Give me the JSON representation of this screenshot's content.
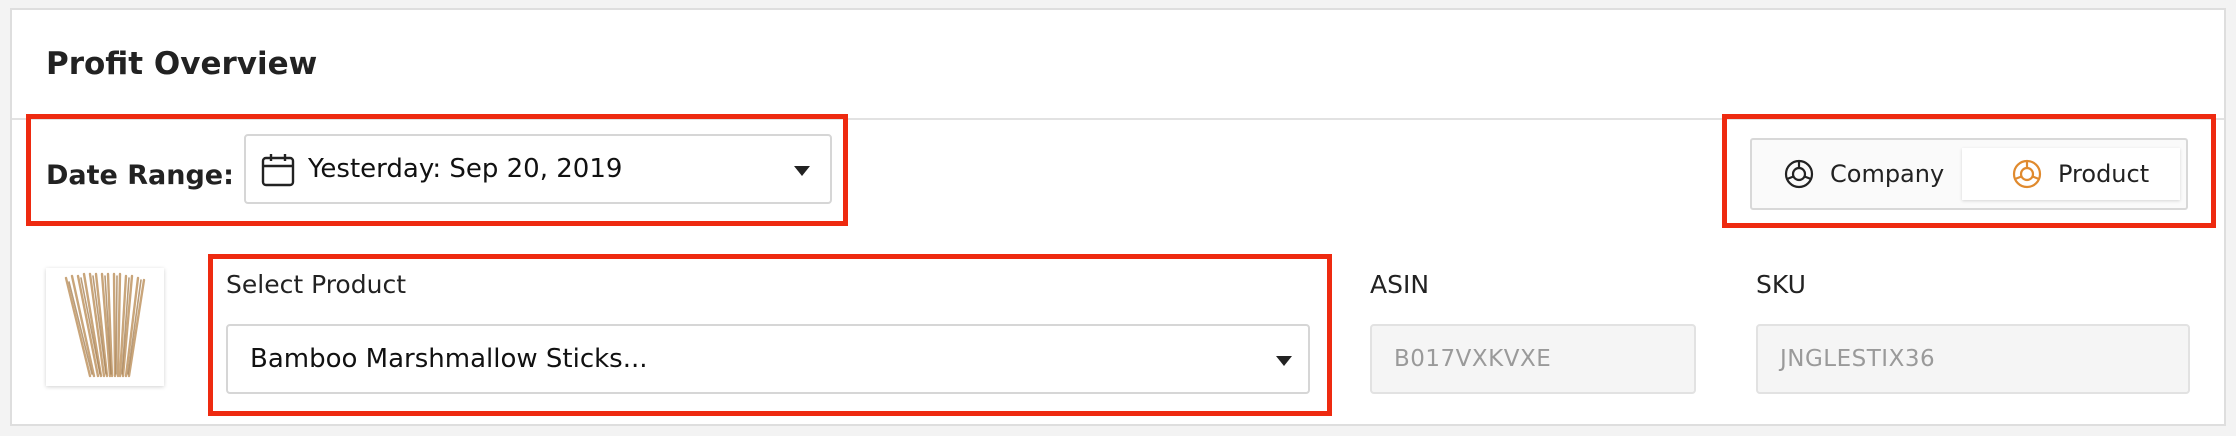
{
  "panel": {
    "title": "Profit Overview"
  },
  "filters": {
    "date_range_label": "Date Range:",
    "date_range_value": "Yesterday: Sep 20, 2019"
  },
  "view_toggle": {
    "company_label": "Company",
    "product_label": "Product",
    "selected": "Product"
  },
  "product": {
    "select_label": "Select Product",
    "selected_value": "Bamboo Marshmallow Sticks...",
    "asin_label": "ASIN",
    "asin_value": "B017VXKVXE",
    "sku_label": "SKU",
    "sku_value": "JNGLESTIX36"
  },
  "colors": {
    "highlight": "#ee2a10",
    "product_icon": "#e08a2e",
    "readonly_text": "#9a9a9a"
  },
  "icons": [
    "calendar-icon",
    "chevron-down-icon",
    "pie-chart-icon",
    "product-image"
  ]
}
